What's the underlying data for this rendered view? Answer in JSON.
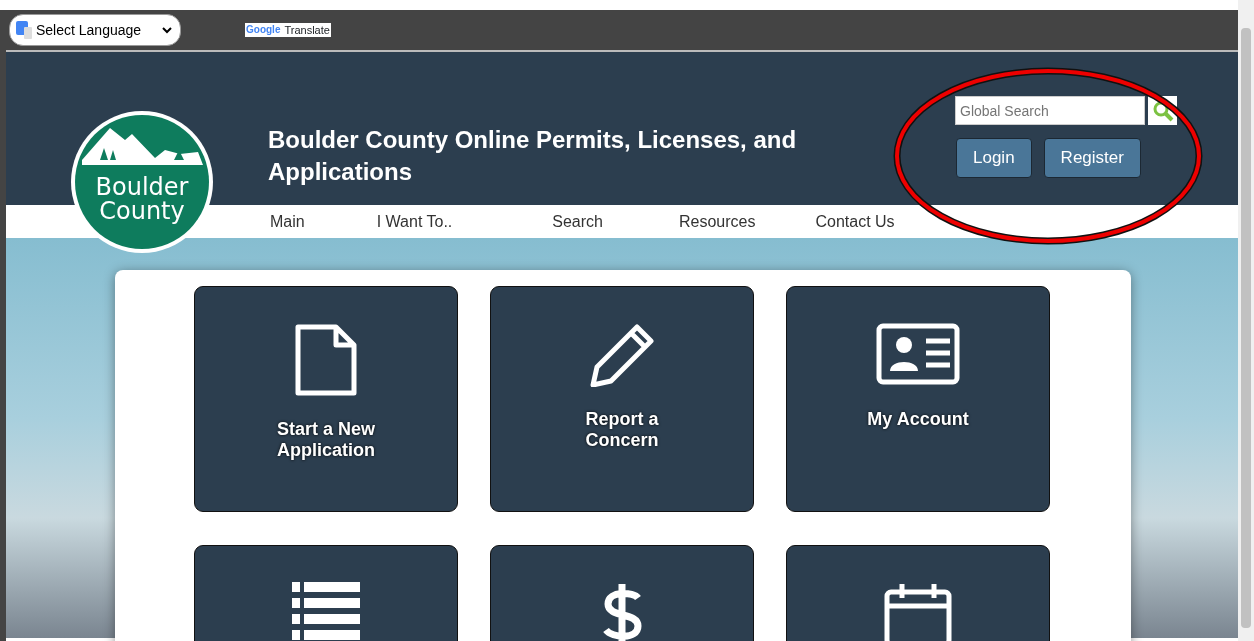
{
  "translate_bar": {
    "language_select": "Select Language",
    "google_brand": "Google",
    "translate_label": "Translate"
  },
  "header": {
    "logo_text": [
      "Boulder",
      "County"
    ],
    "title": "Boulder County Online Permits, Licenses, and Applications",
    "search": {
      "placeholder": "Global Search"
    },
    "buttons": [
      "Login",
      "Register"
    ]
  },
  "nav": [
    "Main",
    "I Want To..",
    "Search",
    "Resources",
    "Contact Us"
  ],
  "tiles": [
    {
      "kind": "document",
      "label": "Start a New Application"
    },
    {
      "kind": "pencil",
      "label": "Report a Concern"
    },
    {
      "kind": "id-card",
      "label": "My Account"
    },
    {
      "kind": "list"
    },
    {
      "kind": "dollar"
    },
    {
      "kind": "calendar"
    }
  ]
}
